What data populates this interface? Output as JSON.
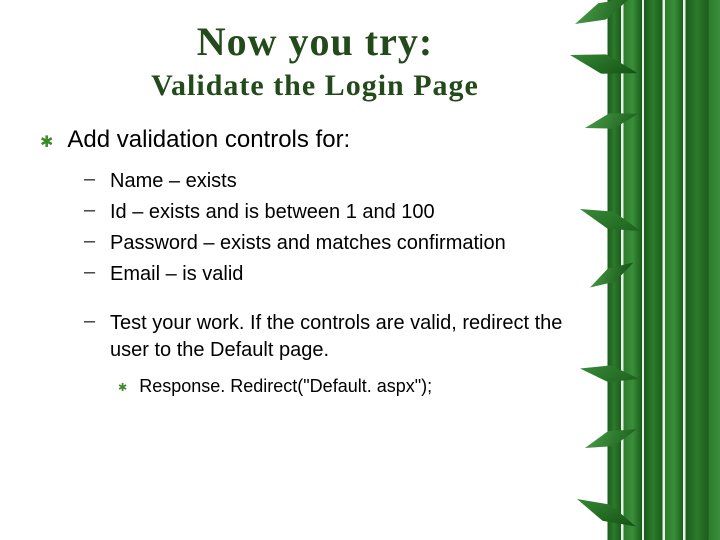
{
  "title": {
    "line1": "Now you try:",
    "line2": "Validate the Login Page"
  },
  "mainBullet": "Add validation controls for:",
  "subItems": [
    "Name – exists",
    "Id – exists and is between 1 and 100",
    "Password – exists and matches confirmation",
    "Email – is valid"
  ],
  "followUp": "Test your work.  If the controls are valid, redirect the user to the Default page.",
  "codeLine": "Response. Redirect(\"Default. aspx\");"
}
